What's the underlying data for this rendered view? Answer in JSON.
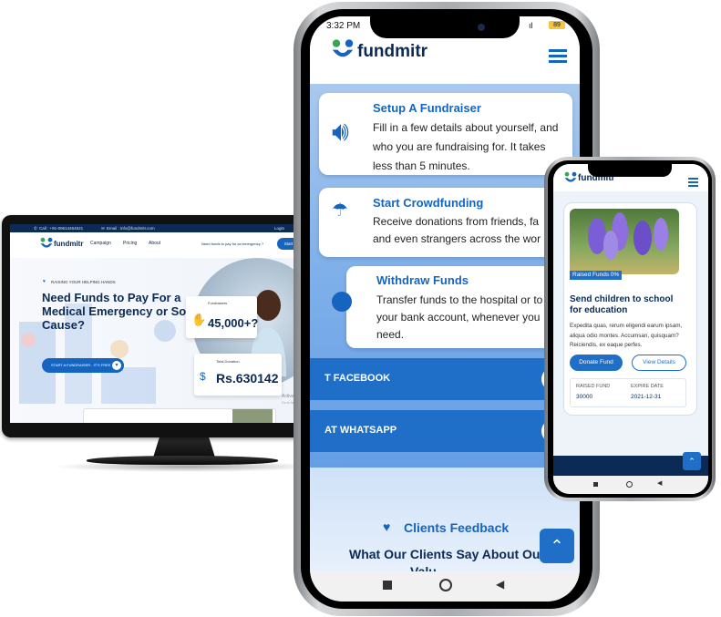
{
  "colors": {
    "brand_blue": "#1565c0",
    "navy": "#0b2a55",
    "accent": "#2e7fd1",
    "green": "#3aa655"
  },
  "desktop": {
    "topbar": {
      "call": "Call : +91-09614464521",
      "email": "Email : info@fundmitr.com",
      "login": "Login",
      "create": "Create Account"
    },
    "logo": "fundmitr",
    "nav": [
      "Campaign",
      "Pricing",
      "About"
    ],
    "emergency": "Need funds to pay for an emergency ?",
    "start_btn": "Start a fundraiser",
    "tagline": "RAISING YOUR HELPING HANDS",
    "headline_1": "Need Funds to Pay For a",
    "headline_2": "Medical Emergency or Social",
    "headline_3": "Cause?",
    "cta": "START A FUNDRAISER - IT'S FREE",
    "fundraisers_label": "Fundraisers",
    "fundraisers_value": "45,000+?",
    "donation_label": "Total Donation",
    "donation_value": "Rs.630142",
    "activate_1": "Activate Windows",
    "activate_2": "Go to Settings to activate Windows."
  },
  "phone": {
    "status_time": "3:32 PM",
    "status_battery": "89",
    "logo": "fundmitr",
    "cards": [
      {
        "title": "Setup A Fundraiser",
        "text_1": "Fill in a few details about yourself, and",
        "text_2": "who you are fundraising for. It takes",
        "text_3": "less than 5 minutes."
      },
      {
        "title": "Start Crowdfunding",
        "text_1": "Receive donations from friends, fa",
        "text_2": "and even strangers across the wor"
      },
      {
        "title": "Withdraw Funds",
        "text_1": "Transfer funds to the hospital or to",
        "text_2": "your bank account, whenever you",
        "text_3": "need."
      }
    ],
    "share_facebook": "T FACEBOOK",
    "share_whatsapp": "AT WHATSAPP",
    "feedback_label": "Clients Feedback",
    "feedback_title": "What Our Clients Say About Our",
    "feedback_title_2": "Valu"
  },
  "small_phone": {
    "logo": "fundmitr",
    "raised_badge": "Raised Funds 0%",
    "campaign_title_1": "Send children to school",
    "campaign_title_2": "for education",
    "desc_1": "Expedita quas, rerum eligendi earum ipsam,",
    "desc_2": "aliqua odio montes. Accumsan, quisquam?",
    "desc_3": "Reiciendis, ex eaque perfes.",
    "donate_btn": "Donate Fund",
    "details_btn": "View Details",
    "raised_label": "RAISED FUND",
    "raised_value": "30000",
    "expire_label": "EXPIRE DATE",
    "expire_value": "2021-12-31"
  }
}
